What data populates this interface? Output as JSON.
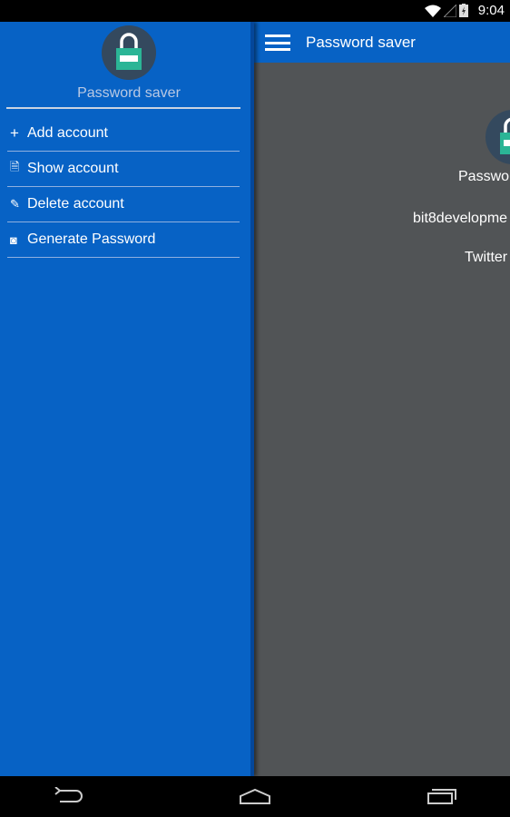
{
  "status_bar": {
    "time": "9:04",
    "icons": [
      "wifi-icon",
      "signal-icon",
      "battery-charging-icon"
    ]
  },
  "app_bar": {
    "title": "Password saver",
    "menu_icon": "hamburger-icon"
  },
  "drawer": {
    "app_name": "Password saver",
    "items": [
      {
        "label": "Add account",
        "icon": "plus-icon"
      },
      {
        "label": "Show account",
        "icon": "document-icon"
      },
      {
        "label": "Delete account",
        "icon": "pencil-icon"
      },
      {
        "label": "Generate Password",
        "icon": "lock-circle-icon"
      }
    ]
  },
  "main": {
    "heading": "Passwo",
    "account": "bit8developme",
    "service": "Twitter"
  },
  "colors": {
    "primary": "#0762c5",
    "content_bg": "#515456",
    "logo_bg": "#34495e",
    "lock_green": "#2bb596"
  },
  "nav_bar": {
    "buttons": [
      "back-icon",
      "home-icon",
      "recents-icon"
    ]
  }
}
